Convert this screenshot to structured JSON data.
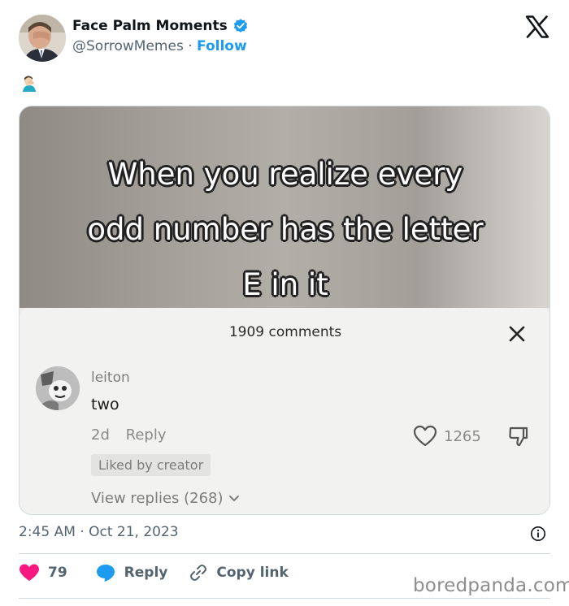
{
  "header": {
    "display_name": "Face Palm Moments",
    "handle": "@SorrowMemes",
    "separator": "·",
    "follow_label": "Follow"
  },
  "post": {
    "emoji_icon": "facepalm-emoji"
  },
  "meme": {
    "caption_line1": "When you realize every",
    "caption_line2": "odd number has the letter",
    "caption_line3": "E in it",
    "comments_count": "1909 comments",
    "comment": {
      "user": "leiton",
      "text": "two",
      "age": "2d",
      "reply_label": "Reply",
      "likes": "1265",
      "liked_by": "Liked by creator",
      "view_replies": "View replies (268)"
    }
  },
  "meta": {
    "timestamp": "2:45 AM · Oct 21, 2023"
  },
  "actions": {
    "likes": "79",
    "reply_label": "Reply",
    "copy_label": "Copy link"
  },
  "watermark": "boredpanda.com",
  "colors": {
    "accent": "#1d9bf0",
    "like": "#f91880",
    "text": "#0f1419",
    "secondary": "#536471"
  }
}
